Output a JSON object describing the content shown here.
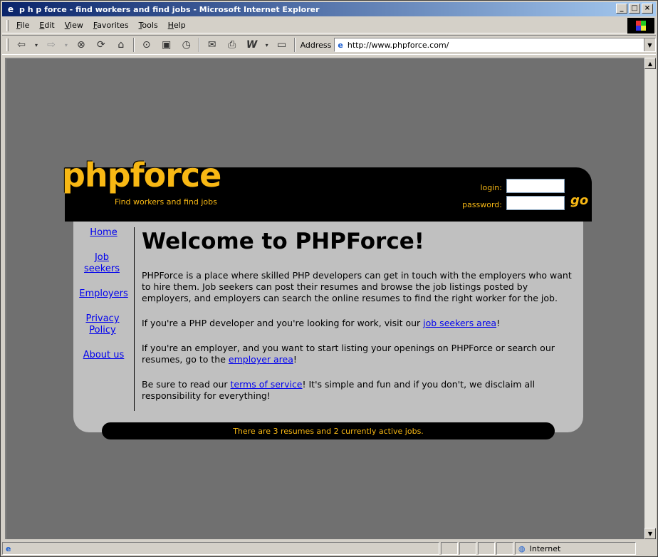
{
  "window": {
    "title": "p h p force - find workers and find jobs - Microsoft Internet Explorer",
    "controls": [
      "_",
      "□",
      "×"
    ]
  },
  "menu": [
    "File",
    "Edit",
    "View",
    "Favorites",
    "Tools",
    "Help"
  ],
  "address": {
    "label": "Address",
    "url": "http://www.phpforce.com/"
  },
  "page": {
    "logo": "phpforce",
    "tagline": "Find workers and find jobs",
    "login_label": "login:",
    "password_label": "password:",
    "go_label": "go",
    "nav": [
      {
        "label": "Home"
      },
      {
        "label": "Job seekers"
      },
      {
        "label": "Employers"
      },
      {
        "label": "Privacy Policy"
      },
      {
        "label": "About us"
      }
    ],
    "heading": "Welcome to PHPForce!",
    "para1": "PHPForce is a place where skilled PHP developers can get in touch with the employers who want to hire them. Job seekers can post their resumes and browse the job listings posted by employers, and employers can search the online resumes to find the right worker for the job.",
    "para2_before": "If you're a PHP developer and you're looking for work, visit our ",
    "para2_link": "job seekers area",
    "para2_after": "!",
    "para3_before": "If you're an employer, and you want to start listing your openings on PHPForce or search our resumes, go to the ",
    "para3_link": "employer area",
    "para3_after": "!",
    "para4_before": "Be sure to read our ",
    "para4_link": "terms of service",
    "para4_after": "! It's simple and fun and if you don't, we disclaim all responsibility for everything!",
    "footer": "There are 3 resumes and 2 currently active jobs."
  },
  "status": {
    "zone": "Internet"
  },
  "colors": {
    "accent": "#f8b814",
    "header_bg": "#000000",
    "panel_bg": "#c0c0c0",
    "page_bg": "#707070",
    "link": "#0000ee"
  }
}
